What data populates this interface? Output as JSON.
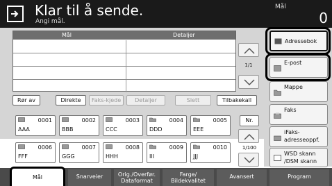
{
  "header": {
    "title": "Klar til å sende.",
    "subtitle": "Angi mål.",
    "mal_label": "Mål",
    "mal_count": "0"
  },
  "list": {
    "col_target": "Mål",
    "col_details": "Detaljer",
    "page": "1/1"
  },
  "actions": {
    "ror_av": "Rør av",
    "direkte": "Direkte",
    "faks_kjede": "Faks-kjede",
    "detaljer": "Detaljer",
    "slett": "Slett",
    "tilbakekall": "Tilbakekall"
  },
  "quick": {
    "nr": "Nr.",
    "page": "1/100",
    "tiles": [
      {
        "num": "0001",
        "name": "AAA"
      },
      {
        "num": "0002",
        "name": "BBB"
      },
      {
        "num": "0003",
        "name": "CCC"
      },
      {
        "num": "0004",
        "name": "DDD"
      },
      {
        "num": "0005",
        "name": "EEE"
      },
      {
        "num": "0006",
        "name": "FFF"
      },
      {
        "num": "0007",
        "name": "GGG"
      },
      {
        "num": "0008",
        "name": "HHH"
      },
      {
        "num": "0009",
        "name": "III"
      },
      {
        "num": "0010",
        "name": "JJJ"
      }
    ]
  },
  "right": {
    "adressebok": "Adressebok",
    "epost": "E-post",
    "mappe": "Mappe",
    "faks": "Faks",
    "ifaks_1": "iFaks-",
    "ifaks_2": "adresseoppf.",
    "wsd_1": "WSD skann",
    "wsd_2": "/DSM skann"
  },
  "tabs": {
    "mal": "Mål",
    "snarveier": "Snarveier",
    "orig_1": "Orig./Overfør.",
    "orig_2": "Dataformat",
    "farge_1": "Farge/",
    "farge_2": "Bildekvalitet",
    "avansert": "Avansert",
    "program": "Program"
  }
}
